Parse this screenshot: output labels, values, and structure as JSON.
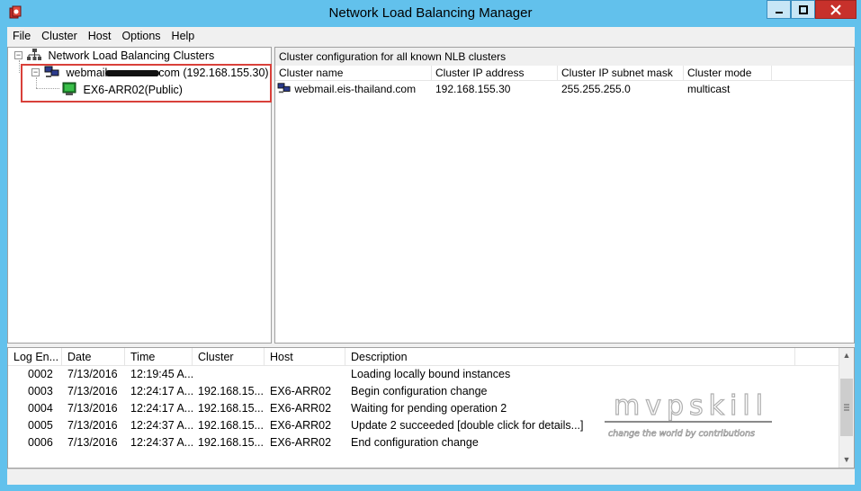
{
  "window": {
    "title": "Network Load Balancing Manager"
  },
  "menu": {
    "items": [
      "File",
      "Cluster",
      "Host",
      "Options",
      "Help"
    ]
  },
  "tree": {
    "root_label": "Network Load Balancing Clusters",
    "cluster_label_prefix": "webmail.",
    "cluster_label_suffix": ".com (192.168.155.30)",
    "host_label": "EX6-ARR02(Public)"
  },
  "cluster_table": {
    "header": "Cluster configuration for all known NLB clusters",
    "columns": [
      "Cluster name",
      "Cluster IP address",
      "Cluster IP subnet mask",
      "Cluster mode"
    ],
    "rows": [
      [
        "webmail.eis-thailand.com",
        "192.168.155.30",
        "255.255.255.0",
        "multicast"
      ]
    ]
  },
  "log": {
    "columns": [
      "Log En...",
      "Date",
      "Time",
      "Cluster",
      "Host",
      "Description"
    ],
    "rows": [
      [
        "0002",
        "7/13/2016",
        "12:19:45 A...",
        "",
        "",
        "Loading locally bound instances"
      ],
      [
        "0003",
        "7/13/2016",
        "12:24:17 A...",
        "192.168.15...",
        "EX6-ARR02",
        "Begin configuration change"
      ],
      [
        "0004",
        "7/13/2016",
        "12:24:17 A...",
        "192.168.15...",
        "EX6-ARR02",
        "Waiting for pending operation 2"
      ],
      [
        "0005",
        "7/13/2016",
        "12:24:37 A...",
        "192.168.15...",
        "EX6-ARR02",
        "Update 2 succeeded [double click for details...]"
      ],
      [
        "0006",
        "7/13/2016",
        "12:24:37 A...",
        "192.168.15...",
        "EX6-ARR02",
        "End configuration change"
      ]
    ]
  },
  "watermark": {
    "brand": "mvpskill",
    "tagline": "change the world by contributions"
  },
  "colors": {
    "titlebar": "#62c1ec",
    "close_button": "#c7312b",
    "highlight_box": "#d9403a"
  }
}
